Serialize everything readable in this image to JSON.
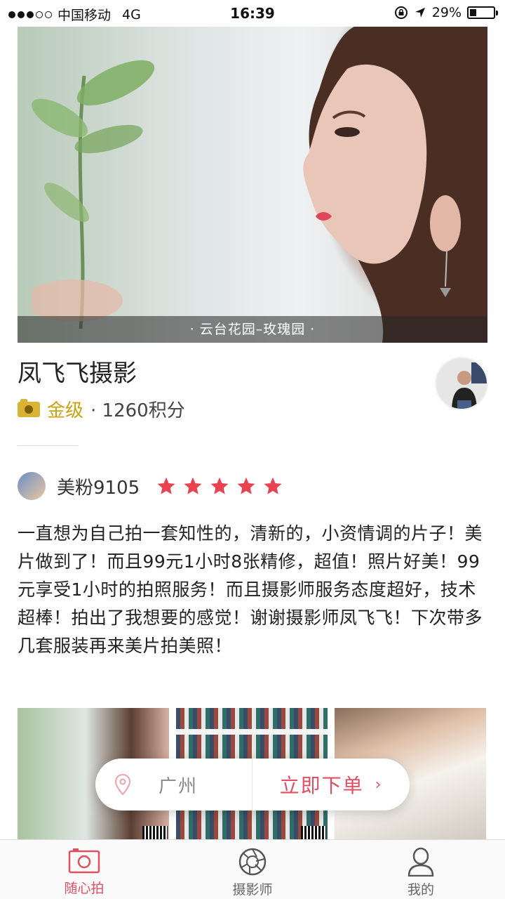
{
  "status_bar": {
    "carrier": "中国移动",
    "network": "4G",
    "time": "16:39",
    "battery": "29%",
    "battery_level": 0.29,
    "icons": [
      "lock-rotation-icon",
      "location-arrow-icon",
      "battery-icon"
    ]
  },
  "hero": {
    "caption": "· 云台花园–玫瑰园 ·"
  },
  "store": {
    "name": "凤飞飞摄影",
    "level": "金级",
    "points": "· 1260积分"
  },
  "review": {
    "user": "美粉9105",
    "rating": 5,
    "text": "一直想为自己拍一套知性的，清新的，小资情调的片子！美片做到了！而且99元1小时8张精修，超值！照片好美！99元享受1小时的拍照服务！而且摄影师服务态度超好，技术超棒！拍出了我想要的感觉！谢谢摄影师凤飞飞！下次带多几套服装再来美片拍美照！"
  },
  "order_pill": {
    "city": "广州",
    "action": "立即下单",
    "chevron": "›"
  },
  "tabs": [
    {
      "label": "随心拍",
      "icon": "camera-icon",
      "active": true
    },
    {
      "label": "摄影师",
      "icon": "aperture-icon",
      "active": false
    },
    {
      "label": "我的",
      "icon": "person-icon",
      "active": false
    }
  ],
  "colors": {
    "accent": "#e15060",
    "gold": "#c9a20e",
    "star": "#e8434f"
  }
}
